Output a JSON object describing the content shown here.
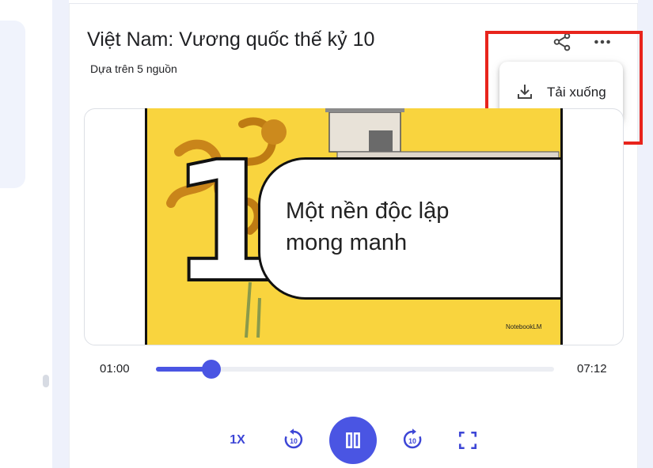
{
  "notebook": {
    "title": "Việt Nam: Vương quốc thế kỷ 10",
    "subtitle": "Dựa trên 5 nguồn"
  },
  "toolbar": {
    "share_icon": "share-icon",
    "more_icon": "more-horizontal-icon"
  },
  "menu": {
    "items": [
      {
        "label": "Tải xuống",
        "icon": "download-icon"
      }
    ]
  },
  "video": {
    "slide_number": "1",
    "slide_heading_line1": "Một nền độc lập",
    "slide_heading_line2": "mong manh",
    "brand": "NotebookLM"
  },
  "player": {
    "current_time": "01:00",
    "total_time": "07:12",
    "progress": 0.139,
    "speed_label": "1X",
    "rewind_icon": "replay-10-icon",
    "play_state_icon": "pause-icon",
    "forward_icon": "forward-10-icon",
    "fullscreen_icon": "fullscreen-icon",
    "accent_color": "#4a55e3"
  },
  "highlight_color": "#e8241c"
}
